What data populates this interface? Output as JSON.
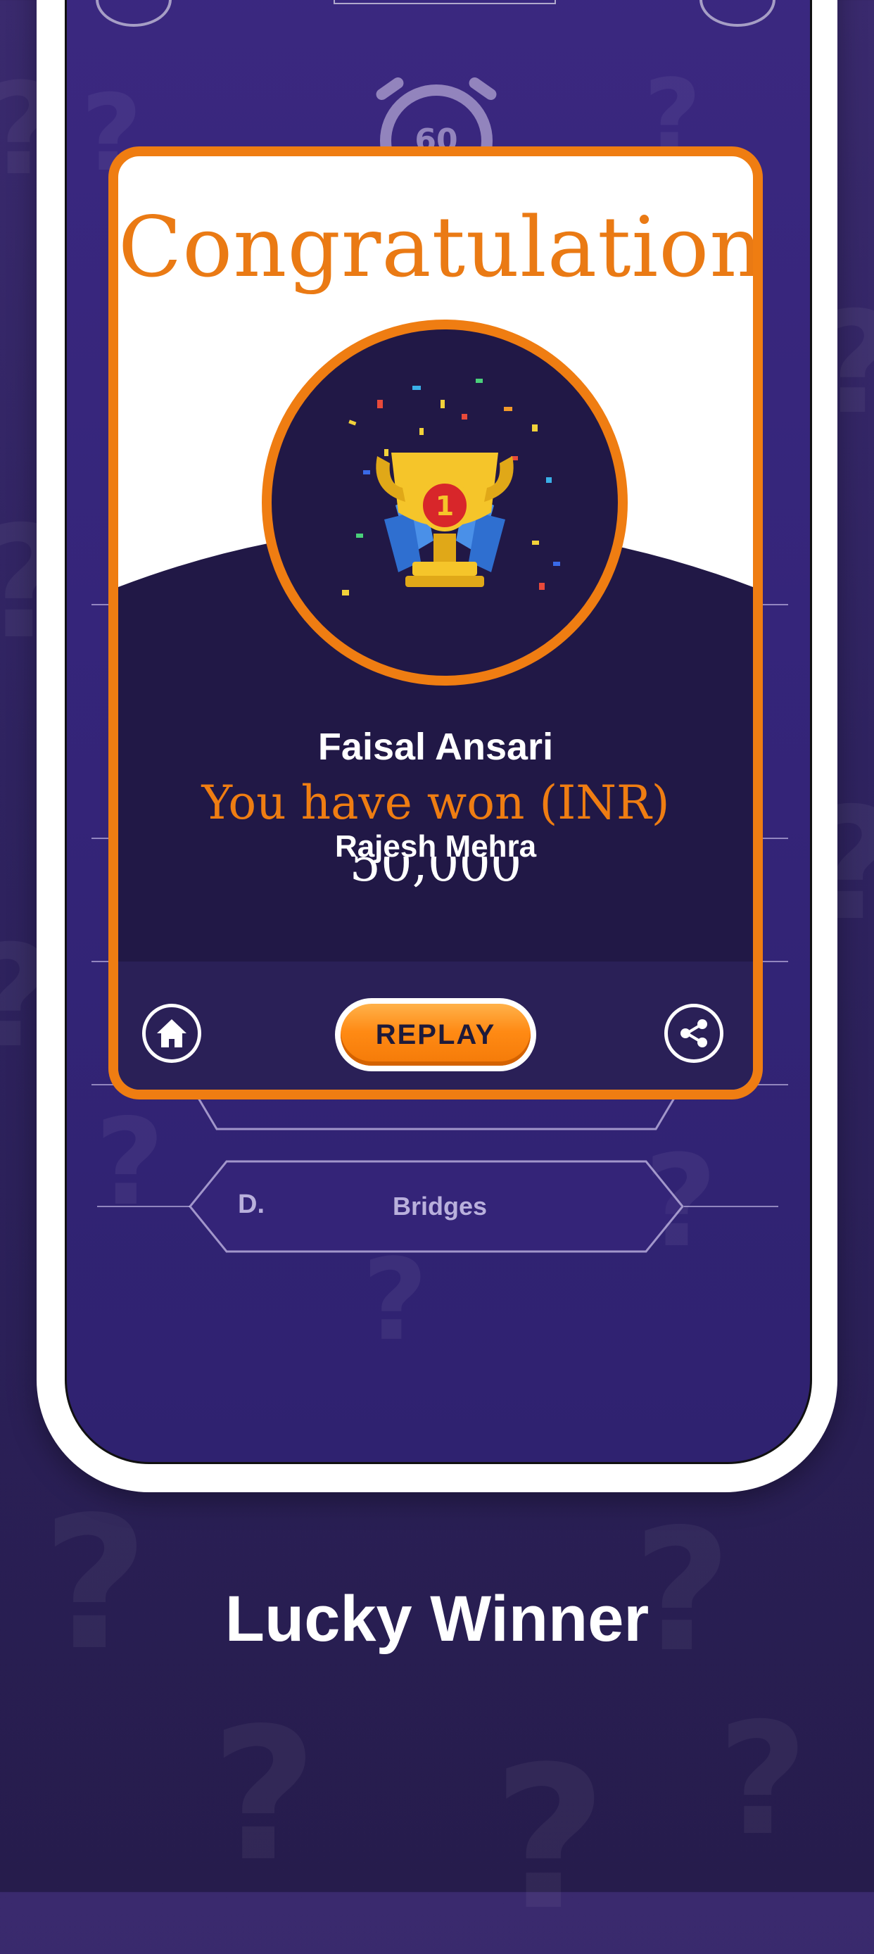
{
  "modal": {
    "title": "Congratulations",
    "winner_name": "Faisal Ansari",
    "won_label": "You have won (INR)",
    "second_name": "Rajesh Mehra",
    "amount": "50,000",
    "replay_label": "REPLAY"
  },
  "question": {
    "option_d_letter": "D.",
    "option_d_text": "Bridges"
  },
  "footer": {
    "tagline": "Lucky Winner"
  },
  "icons": {
    "home": "home-icon",
    "share": "share-icon",
    "trophy": "trophy-icon",
    "timer": "timer-icon"
  },
  "colors": {
    "accent": "#ef7d12",
    "background": "#2f2360",
    "modal_dark": "#211846"
  },
  "timer": {
    "seconds": "60"
  }
}
